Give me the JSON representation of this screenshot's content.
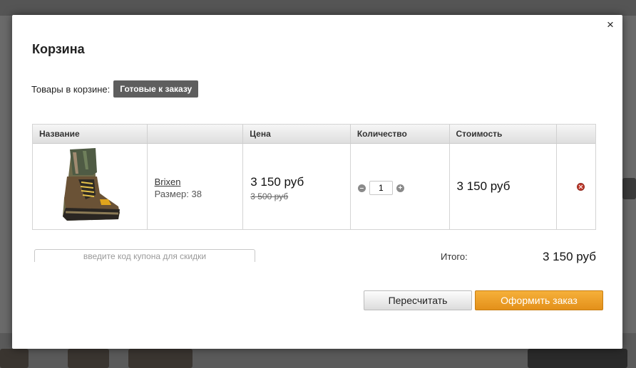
{
  "cart": {
    "title": "Корзина",
    "tabs_label": "Товары в корзине:",
    "active_tab": "Готовые к заказу",
    "columns": [
      "Название",
      "",
      "Цена",
      "Количество",
      "Стоимость",
      ""
    ],
    "items": [
      {
        "name": "Brixen",
        "size": "Размер: 38",
        "price": "3 150 руб",
        "old_price": "3 500 руб",
        "quantity": "1",
        "cost": "3 150 руб"
      }
    ],
    "coupon_placeholder": "введите код купона для скидки",
    "total_label": "Итого:",
    "total_value": "3 150 руб",
    "recalc_label": "Пересчитать",
    "order_label": "Оформить заказ"
  },
  "qty_minus": "–",
  "qty_plus": "+",
  "close_symbol": "×",
  "colors": {
    "order_button": "#e3901a",
    "active_tab": "#5e5e5e",
    "remove_icon": "#c0392b"
  }
}
